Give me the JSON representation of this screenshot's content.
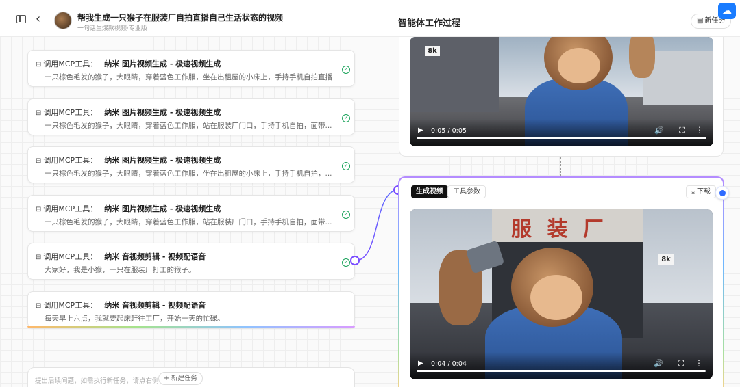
{
  "header": {
    "title": "帮我生成一只猴子在服装厂自拍直播自己生活状态的视频",
    "subtitle": "一句话生爆款视频·专业版",
    "center_title": "智能体工作过程",
    "new_task_label": "新任务"
  },
  "steps": [
    {
      "prefix": "调用MCP工具：",
      "tool": "纳米 图片视频生成 - 极速视频生成",
      "desc": "一只棕色毛发的猴子，大眼睛，穿着蓝色工作服，坐在出租屋的小床上，手持手机自拍直播"
    },
    {
      "prefix": "调用MCP工具：",
      "tool": "纳米 图片视频生成 - 极速视频生成",
      "desc": "一只棕色毛发的猴子，大眼睛，穿着蓝色工作服，站在服装厂门口，手持手机自拍，面带..."
    },
    {
      "prefix": "调用MCP工具：",
      "tool": "纳米 图片视频生成 - 极速视频生成",
      "desc": "一只棕色毛发的猴子，大眼睛，穿着蓝色工作服，坐在出租屋的小床上，手持手机自拍，..."
    },
    {
      "prefix": "调用MCP工具：",
      "tool": "纳米 图片视频生成 - 极速视频生成",
      "desc": "一只棕色毛发的猴子，大眼睛，穿着蓝色工作服，站在服装厂门口，手持手机自拍，面带..."
    },
    {
      "prefix": "调用MCP工具：",
      "tool": "纳米 音视频剪辑 - 视频配语音",
      "desc": "大家好，我是小猴，一只在服装厂打工的猴子。"
    },
    {
      "prefix": "调用MCP工具：",
      "tool": "纳米 音视频剪辑 - 视频配语音",
      "desc": "每天早上六点，我就要起床赶往工厂，开始一天的忙碌。"
    }
  ],
  "chat_input": {
    "placeholder": "提出后续问题，如需执行新任务，请点右侧",
    "new_task_chip": "+ 新建任务"
  },
  "video_top": {
    "time": "0:05 / 0:05",
    "progress": 1.0,
    "sign": "8k"
  },
  "active_card": {
    "tab_active": "生成视频",
    "tab_inactive": "工具参数",
    "download_label": "下载",
    "video": {
      "time": "0:04 / 0:04",
      "progress": 1.0,
      "sign_text": "服 装 厂",
      "sign_small": "8k"
    }
  },
  "colors": {
    "check": "#1aa35a",
    "accent": "#7a4dff",
    "brand_blue": "#1a7cff"
  }
}
